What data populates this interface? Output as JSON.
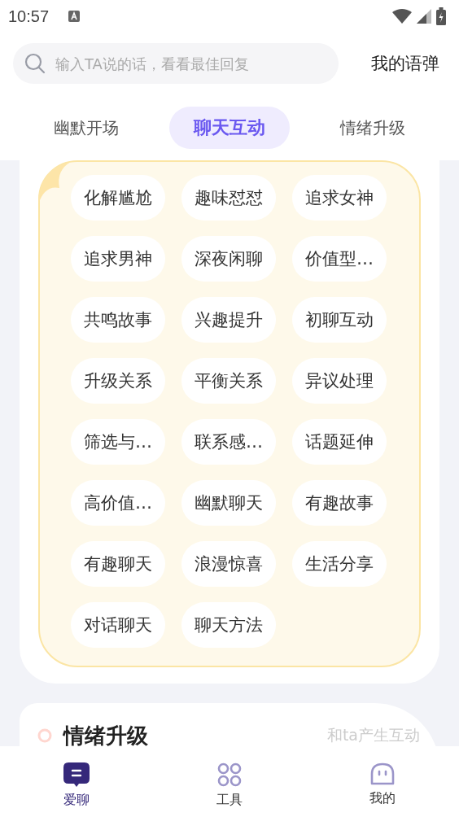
{
  "status_bar": {
    "time": "10:57"
  },
  "search": {
    "placeholder": "输入TA说的话，看看最佳回复"
  },
  "my_phrases_link": "我的语弹",
  "tabs": [
    {
      "label": "幽默开场",
      "selected": false
    },
    {
      "label": "聊天互动",
      "selected": true
    },
    {
      "label": "情绪升级",
      "selected": false
    }
  ],
  "topics": [
    "化解尴尬",
    "趣味怼怼",
    "追求女神",
    "追求男神",
    "深夜闲聊",
    "价值型…",
    "共鸣故事",
    "兴趣提升",
    "初聊互动",
    "升级关系",
    "平衡关系",
    "异议处理",
    "筛选与…",
    "联系感…",
    "话题延伸",
    "高价值…",
    "幽默聊天",
    "有趣故事",
    "有趣聊天",
    "浪漫惊喜",
    "生活分享",
    "对话聊天",
    "聊天方法"
  ],
  "next_section": {
    "title": "情绪升级",
    "subtitle": "和ta产生互动"
  },
  "bottom_nav": [
    {
      "label": "爱聊",
      "kind": "chat",
      "selected": true
    },
    {
      "label": "工具",
      "kind": "tools",
      "selected": false
    },
    {
      "label": "我的",
      "kind": "profile",
      "selected": false
    }
  ]
}
